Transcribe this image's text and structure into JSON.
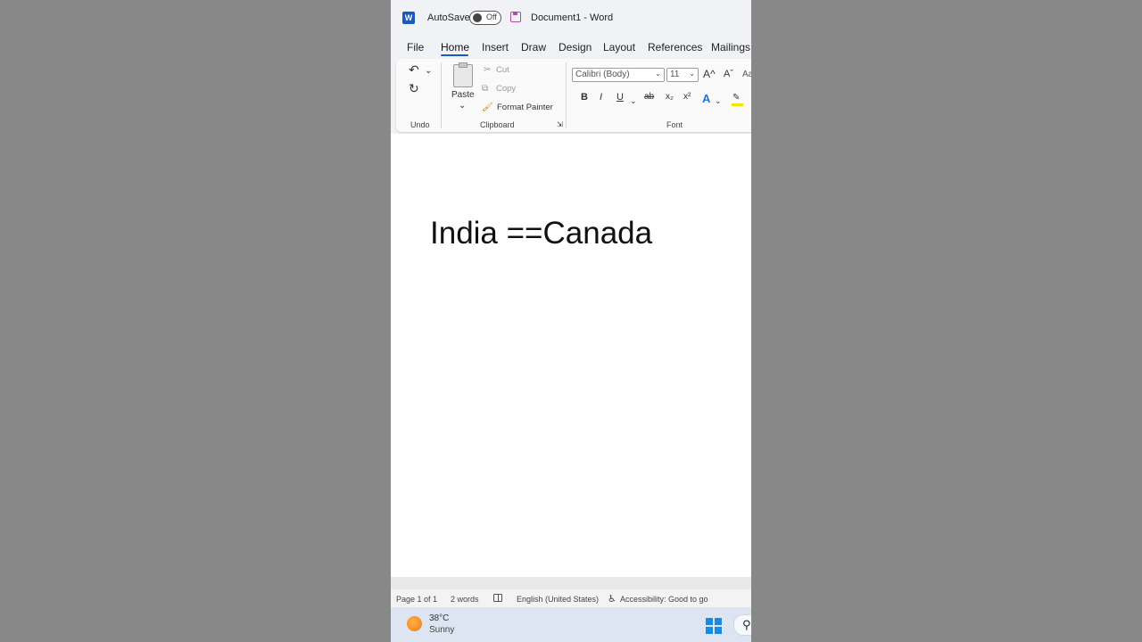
{
  "titlebar": {
    "app_icon": "word-icon",
    "app_letter": "W",
    "autosave_label": "AutoSave",
    "autosave_state": "Off",
    "doc_title": "Document1  -  Word"
  },
  "tabs": [
    "File",
    "Home",
    "Insert",
    "Draw",
    "Design",
    "Layout",
    "References",
    "Mailings"
  ],
  "active_tab": "Home",
  "ribbon": {
    "undo": {
      "group_label": "Undo"
    },
    "clipboard": {
      "paste_label": "Paste",
      "cut_label": "Cut",
      "copy_label": "Copy",
      "format_painter_label": "Format Painter",
      "group_label": "Clipboard"
    },
    "font": {
      "font_name": "Calibri (Body)",
      "font_size": "11",
      "bold": "B",
      "italic": "I",
      "underline": "U",
      "strikethrough": "ab",
      "subscript": "x₂",
      "superscript": "x²",
      "grow_font": "A^",
      "shrink_font": "Aˇ",
      "change_case": "Aa",
      "text_effects": "A",
      "group_label": "Font"
    }
  },
  "document": {
    "text": "India ==Canada"
  },
  "statusbar": {
    "page": "Page 1 of 1",
    "words": "2 words",
    "language": "English (United States)",
    "accessibility": "Accessibility: Good to go"
  },
  "taskbar": {
    "temperature": "38°C",
    "condition": "Sunny"
  },
  "colors": {
    "accent": "#185abd",
    "save_icon": "#b04aa6",
    "page_bg": "#ffffff",
    "backdrop": "#888888"
  }
}
